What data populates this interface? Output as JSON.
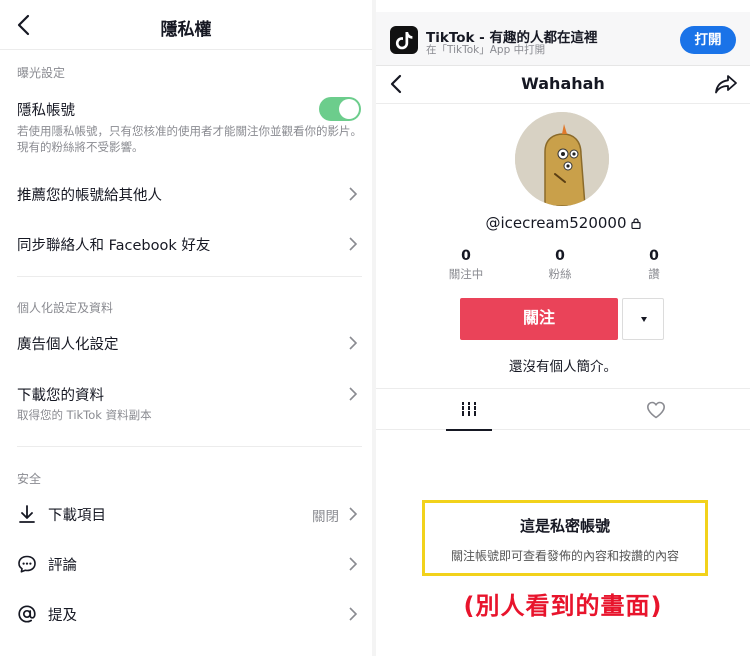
{
  "left": {
    "title": "隱私權",
    "sections": {
      "exposure": "曝光設定",
      "personalization": "個人化設定及資料",
      "safety": "安全"
    },
    "private_account": {
      "label": "隱私帳號",
      "enabled": true,
      "description": "若使用隱私帳號，只有您核准的使用者才能關注你並觀看你的影片。現有的粉絲將不受影響。"
    },
    "suggest_account": "推薦您的帳號給其他人",
    "sync_contacts": "同步聯絡人和 Facebook 好友",
    "ad_personalization": "廣告個人化設定",
    "download_data": {
      "label": "下載您的資料",
      "sub": "取得您的 TikTok 資料副本"
    },
    "downloads": {
      "label": "下載項目",
      "value": "關閉"
    },
    "comments": "評論",
    "mentions": "提及"
  },
  "right": {
    "banner": {
      "title": "TikTok - 有趣的人都在這裡",
      "subtitle": "在「TikTok」App 中打開",
      "open_label": "打開"
    },
    "username": "Wahahah",
    "handle": "@icecream520000",
    "stats": [
      {
        "value": "0",
        "label": "關注中"
      },
      {
        "value": "0",
        "label": "粉絲"
      },
      {
        "value": "0",
        "label": "讚"
      }
    ],
    "follow_label": "關注",
    "bio": "還沒有個人簡介。",
    "private_box": {
      "title": "這是私密帳號",
      "description": "關注帳號即可查看發佈的內容和按讚的內容"
    },
    "annotation": "(別人看到的畫面)"
  },
  "colors": {
    "toggle_on": "#6ccd8c",
    "follow": "#ea4359",
    "open_button": "#1a73e8",
    "highlight_border": "#f2d21b",
    "annotation": "#e8142c"
  }
}
